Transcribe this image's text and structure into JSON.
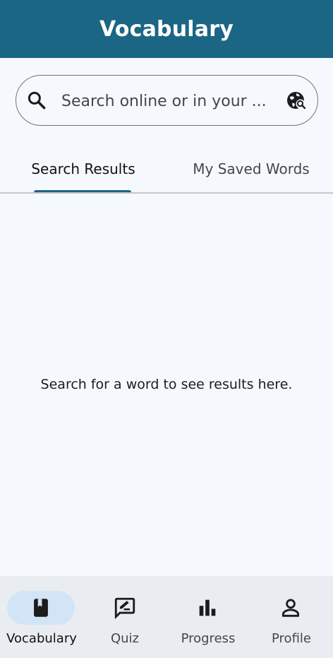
{
  "app_bar": {
    "title": "Vocabulary"
  },
  "search": {
    "placeholder": "Search online or in your ..."
  },
  "tabs": [
    {
      "label": "Search Results",
      "selected": true
    },
    {
      "label": "My Saved Words",
      "selected": false
    }
  ],
  "main": {
    "empty_message": "Search for a word to see results here."
  },
  "bottom_nav": {
    "items": [
      {
        "label": "Vocabulary",
        "icon": "book-icon",
        "active": true
      },
      {
        "label": "Quiz",
        "icon": "quiz-icon",
        "active": false
      },
      {
        "label": "Progress",
        "icon": "bar-chart-icon",
        "active": false
      },
      {
        "label": "Profile",
        "icon": "person-icon",
        "active": false
      }
    ]
  },
  "colors": {
    "primary": "#1b6685",
    "background": "#f5f9fd",
    "nav_background": "#e9edf1",
    "active_pill": "#d2e5f6"
  }
}
